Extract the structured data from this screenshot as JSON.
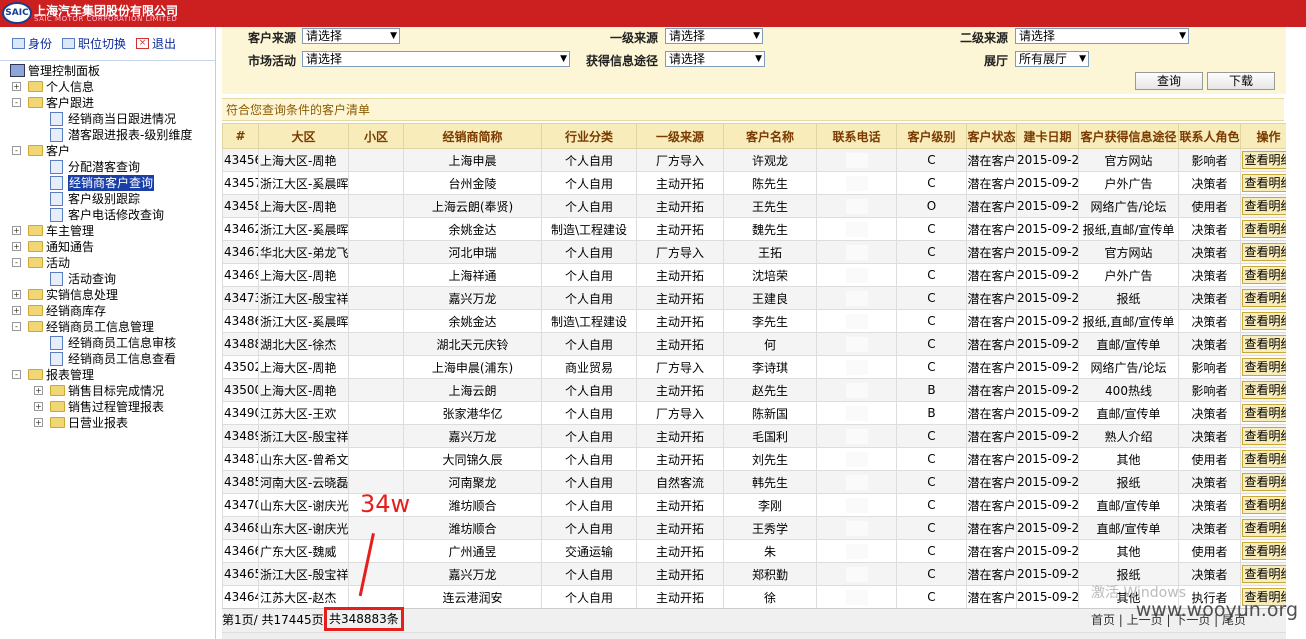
{
  "header": {
    "logo_text": "SAIC",
    "company_cn": "上海汽车集团股份有限公司",
    "company_en": "SAIC MOTOR CORPORATION LIMITED"
  },
  "sidebar": {
    "tools": [
      "身份",
      "职位切换",
      "退出"
    ],
    "tree": [
      {
        "label": "管理控制面板",
        "level": 0,
        "type": "root"
      },
      {
        "label": "个人信息",
        "level": 1,
        "type": "folder",
        "exp": "+"
      },
      {
        "label": "客户跟进",
        "level": 1,
        "type": "folder",
        "exp": "-"
      },
      {
        "label": "经销商当日跟进情况",
        "level": 2,
        "type": "page"
      },
      {
        "label": "潜客跟进报表-级别维度",
        "level": 2,
        "type": "page"
      },
      {
        "label": "客户",
        "level": 1,
        "type": "folder",
        "exp": "-"
      },
      {
        "label": "分配潜客查询",
        "level": 2,
        "type": "page"
      },
      {
        "label": "经销商客户查询",
        "level": 2,
        "type": "page",
        "selected": true
      },
      {
        "label": "客户级别跟踪",
        "level": 2,
        "type": "page"
      },
      {
        "label": "客户电话修改查询",
        "level": 2,
        "type": "page"
      },
      {
        "label": "车主管理",
        "level": 1,
        "type": "folder",
        "exp": "+"
      },
      {
        "label": "通知通告",
        "level": 1,
        "type": "folder",
        "exp": "+"
      },
      {
        "label": "活动",
        "level": 1,
        "type": "folder",
        "exp": "-"
      },
      {
        "label": "活动查询",
        "level": 2,
        "type": "page"
      },
      {
        "label": "实销信息处理",
        "level": 1,
        "type": "folder",
        "exp": "+"
      },
      {
        "label": "经销商库存",
        "level": 1,
        "type": "folder",
        "exp": "+"
      },
      {
        "label": "经销商员工信息管理",
        "level": 1,
        "type": "folder",
        "exp": "-"
      },
      {
        "label": "经销商员工信息审核",
        "level": 2,
        "type": "page"
      },
      {
        "label": "经销商员工信息查看",
        "level": 2,
        "type": "page"
      },
      {
        "label": "报表管理",
        "level": 1,
        "type": "folder",
        "exp": "-"
      },
      {
        "label": "销售目标完成情况",
        "level": 2,
        "type": "folder",
        "exp": "+"
      },
      {
        "label": "销售过程管理报表",
        "level": 2,
        "type": "folder",
        "exp": "+"
      },
      {
        "label": "日营业报表",
        "level": 2,
        "type": "folder",
        "exp": "+"
      }
    ]
  },
  "filters": {
    "customer_source_label": "客户来源",
    "customer_source_value": "请选择",
    "level1_source_label": "一级来源",
    "level1_source_value": "请选择",
    "level2_source_label": "二级来源",
    "level2_source_value": "请选择",
    "market_activity_label": "市场活动",
    "market_activity_value": "请选择",
    "info_channel_label": "获得信息途径",
    "info_channel_value": "请选择",
    "showroom_label": "展厅",
    "showroom_value": "所有展厅",
    "query_button": "查询",
    "download_button": "下载"
  },
  "result_title": "符合您查询条件的客户清单",
  "table": {
    "headers": [
      "#",
      "大区",
      "小区",
      "经销商简称",
      "行业分类",
      "一级来源",
      "客户名称",
      "联系电话",
      "客户级别",
      "客户状态",
      "建卡日期",
      "客户获得信息途径",
      "联系人角色",
      "操作"
    ],
    "action_label": "查看明细",
    "rows": [
      [
        "43456",
        "上海大区-周艳",
        "",
        "上海申晨",
        "个人自用",
        "厂方导入",
        "许观龙",
        "",
        "C",
        "潜在客户",
        "2015-09-24",
        "官方网站",
        "影响者"
      ],
      [
        "43457",
        "浙江大区-奚晨晖",
        "",
        "台州金陵",
        "个人自用",
        "主动开拓",
        "陈先生",
        "",
        "C",
        "潜在客户",
        "2015-09-24",
        "户外广告",
        "决策者"
      ],
      [
        "43458",
        "上海大区-周艳",
        "",
        "上海云朗(奉贤)",
        "个人自用",
        "主动开拓",
        "王先生",
        "",
        "O",
        "潜在客户",
        "2015-09-24",
        "网络广告/论坛",
        "使用者"
      ],
      [
        "43462",
        "浙江大区-奚晨晖",
        "",
        "余姚金达",
        "制造\\工程建设",
        "主动开拓",
        "魏先生",
        "",
        "C",
        "潜在客户",
        "2015-09-24",
        "报纸,直邮/宣传单",
        "决策者"
      ],
      [
        "43467",
        "华北大区-弟龙飞",
        "",
        "河北申瑞",
        "个人自用",
        "厂方导入",
        "王拓",
        "",
        "C",
        "潜在客户",
        "2015-09-24",
        "官方网站",
        "决策者"
      ],
      [
        "43469",
        "上海大区-周艳",
        "",
        "上海祥通",
        "个人自用",
        "主动开拓",
        "沈培荣",
        "",
        "C",
        "潜在客户",
        "2015-09-24",
        "户外广告",
        "决策者"
      ],
      [
        "43473",
        "浙江大区-殷宝祥",
        "",
        "嘉兴万龙",
        "个人自用",
        "主动开拓",
        "王建良",
        "",
        "C",
        "潜在客户",
        "2015-09-24",
        "报纸",
        "决策者"
      ],
      [
        "43486",
        "浙江大区-奚晨晖",
        "",
        "余姚金达",
        "制造\\工程建设",
        "主动开拓",
        "李先生",
        "",
        "C",
        "潜在客户",
        "2015-09-24",
        "报纸,直邮/宣传单",
        "决策者"
      ],
      [
        "43488",
        "湖北大区-徐杰",
        "",
        "湖北天元庆铃",
        "个人自用",
        "主动开拓",
        "何",
        "",
        "C",
        "潜在客户",
        "2015-09-24",
        "直邮/宣传单",
        "决策者"
      ],
      [
        "43502",
        "上海大区-周艳",
        "",
        "上海申晨(浦东)",
        "商业贸易",
        "厂方导入",
        "李诗琪",
        "",
        "C",
        "潜在客户",
        "2015-09-24",
        "网络广告/论坛",
        "影响者"
      ],
      [
        "43500",
        "上海大区-周艳",
        "",
        "上海云朗",
        "个人自用",
        "主动开拓",
        "赵先生",
        "",
        "B",
        "潜在客户",
        "2015-09-24",
        "400热线",
        "影响者"
      ],
      [
        "43490",
        "江苏大区-王欢",
        "",
        "张家港华亿",
        "个人自用",
        "厂方导入",
        "陈新国",
        "",
        "B",
        "潜在客户",
        "2015-09-24",
        "直邮/宣传单",
        "决策者"
      ],
      [
        "43489",
        "浙江大区-殷宝祥",
        "",
        "嘉兴万龙",
        "个人自用",
        "主动开拓",
        "毛国利",
        "",
        "C",
        "潜在客户",
        "2015-09-24",
        "熟人介绍",
        "决策者"
      ],
      [
        "43487",
        "山东大区-曾希文",
        "",
        "大同锦久辰",
        "个人自用",
        "主动开拓",
        "刘先生",
        "",
        "C",
        "潜在客户",
        "2015-09-24",
        "其他",
        "使用者"
      ],
      [
        "43485",
        "河南大区-云晓磊",
        "",
        "河南聚龙",
        "个人自用",
        "自然客流",
        "韩先生",
        "",
        "C",
        "潜在客户",
        "2015-09-24",
        "报纸",
        "决策者"
      ],
      [
        "43470",
        "山东大区-谢庆光",
        "",
        "潍坊顺合",
        "个人自用",
        "主动开拓",
        "李刚",
        "",
        "C",
        "潜在客户",
        "2015-09-24",
        "直邮/宣传单",
        "决策者"
      ],
      [
        "43468",
        "山东大区-谢庆光",
        "",
        "潍坊顺合",
        "个人自用",
        "主动开拓",
        "王秀学",
        "",
        "C",
        "潜在客户",
        "2015-09-24",
        "直邮/宣传单",
        "决策者"
      ],
      [
        "43466",
        "广东大区-魏威",
        "",
        "广州通昱",
        "交通运输",
        "主动开拓",
        "朱",
        "",
        "C",
        "潜在客户",
        "2015-09-24",
        "其他",
        "使用者"
      ],
      [
        "43465",
        "浙江大区-殷宝祥",
        "",
        "嘉兴万龙",
        "个人自用",
        "主动开拓",
        "郑积勤",
        "",
        "C",
        "潜在客户",
        "2015-09-24",
        "报纸",
        "决策者"
      ],
      [
        "43464",
        "江苏大区-赵杰",
        "",
        "连云港润安",
        "个人自用",
        "主动开拓",
        "徐",
        "",
        "C",
        "潜在客户",
        "2015-09-24",
        "其他",
        "执行者"
      ]
    ]
  },
  "pager": {
    "page_info": "第1页/ 共17445页",
    "total": "共348883条",
    "nav": "首页 | 上一页 | 下一页 | 尾页"
  },
  "annotation": "34w",
  "watermark": "www.wooyun.org",
  "watermark_faint": "激活 Windows"
}
